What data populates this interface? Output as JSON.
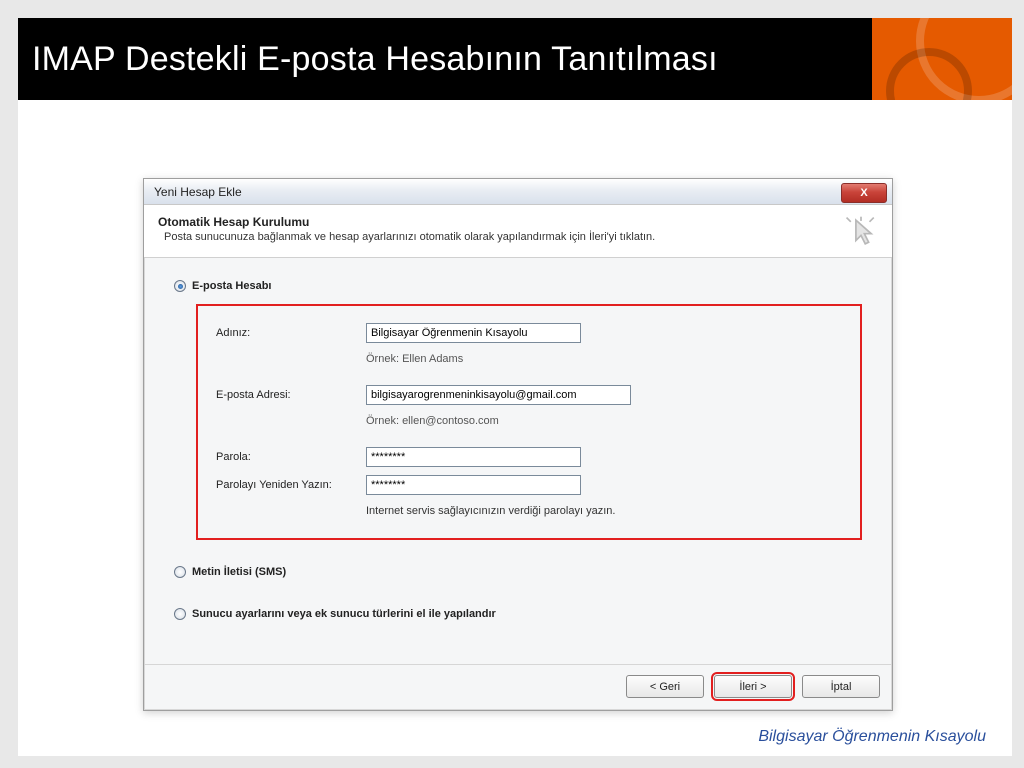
{
  "slide": {
    "title": "IMAP Destekli E-posta Hesabının Tanıtılması",
    "footer": "Bilgisayar Öğrenmenin  Kısayolu"
  },
  "dialog": {
    "title": "Yeni Hesap Ekle",
    "close_symbol": "X",
    "banner": {
      "title": "Otomatik Hesap Kurulumu",
      "subtitle": "Posta sunucunuza bağlanmak ve hesap ayarlarınızı otomatik olarak yapılandırmak için İleri'yi tıklatın."
    },
    "options": {
      "email_account": "E-posta Hesabı",
      "sms": "Metin İletisi (SMS)",
      "manual": "Sunucu ayarlarını veya ek sunucu türlerini el ile yapılandır"
    },
    "form": {
      "name_label": "Adınız:",
      "name_value": "Bilgisayar Öğrenmenin Kısayolu",
      "name_example": "Örnek: Ellen Adams",
      "email_label": "E-posta Adresi:",
      "email_value": "bilgisayarogrenmeninkisayolu@gmail.com",
      "email_example": "Örnek: ellen@contoso.com",
      "password_label": "Parola:",
      "password_value": "********",
      "password2_label": "Parolayı Yeniden Yazın:",
      "password2_value": "********",
      "password_hint": "Internet servis sağlayıcınızın verdiği parolayı yazın."
    },
    "buttons": {
      "back": "< Geri",
      "next": "İleri >",
      "cancel": "İptal"
    }
  }
}
